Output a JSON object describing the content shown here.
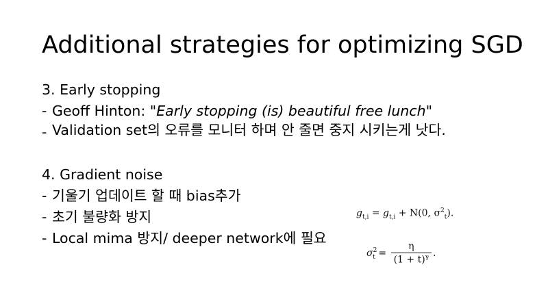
{
  "slide": {
    "title": "Additional strategies for optimizing SGD",
    "section3": {
      "heading": "3. Early stopping",
      "bullets": {
        "b1_prefix": "Geoff Hinton: \"",
        "b1_quote": "Early stopping (is) beautiful free lunch",
        "b1_suffix": "\"",
        "b2": "Validation set의 오류를 모니터 하며 안 줄면 중지 시키는게 낫다."
      }
    },
    "section4": {
      "heading": "4. Gradient noise",
      "bullets": {
        "b1": "기울기 업데이트 할 때 bias추가",
        "b2": "초기 불량화 방지",
        "b3": "Local mima 방지/ deeper network에 필요"
      }
    },
    "dash": "-",
    "formula1": {
      "lhs_g": "g",
      "lhs_sub": "t,i",
      "eq": " = ",
      "rhs_g": "g",
      "rhs_sub": "t,i",
      "rhs_rest": " + N(0, σ",
      "sup": "2",
      "sub2": "t",
      "end": ")."
    },
    "formula2": {
      "sigma": "σ",
      "sup": "2",
      "sub": "t",
      "eq": " = ",
      "num": "η",
      "den": "(1 + t)",
      "den_sup": "γ",
      "end": "."
    }
  }
}
